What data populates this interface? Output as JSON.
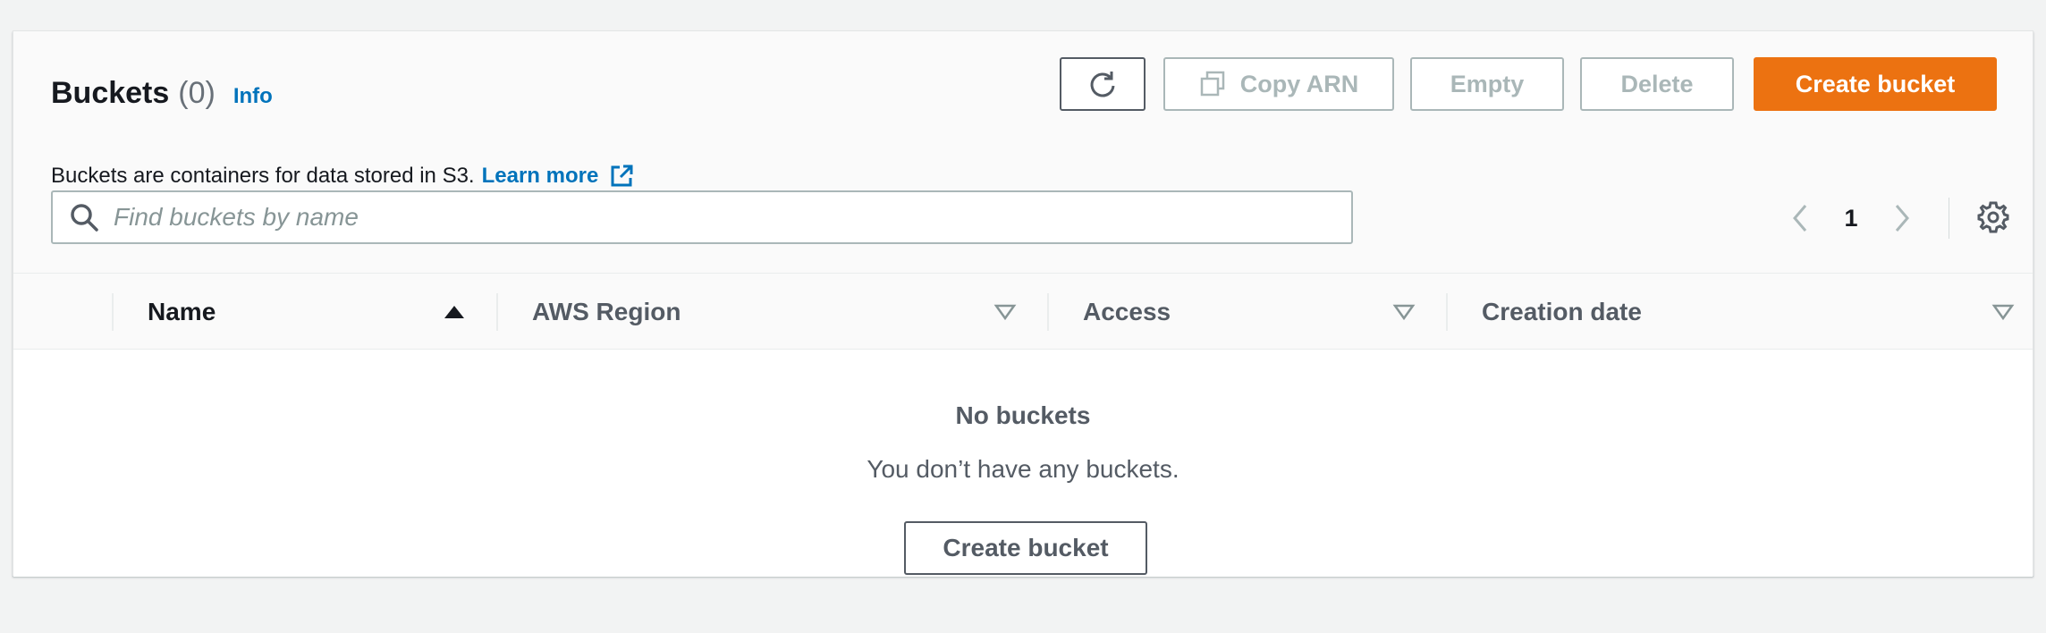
{
  "header": {
    "title": "Buckets",
    "count": "(0)",
    "info_label": "Info",
    "description": "Buckets are containers for data stored in S3.",
    "learn_more": "Learn more"
  },
  "actions": {
    "copy_arn": "Copy ARN",
    "empty": "Empty",
    "delete": "Delete",
    "create_bucket": "Create bucket"
  },
  "search": {
    "placeholder": "Find buckets by name",
    "value": ""
  },
  "pagination": {
    "current_page": "1"
  },
  "table": {
    "columns": [
      "Name",
      "AWS Region",
      "Access",
      "Creation date"
    ],
    "sorted_column": "Name",
    "sort_direction": "ascending",
    "rows": []
  },
  "empty_state": {
    "title": "No buckets",
    "description": "You don’t have any buckets.",
    "button": "Create bucket"
  },
  "icons": {
    "refresh": "refresh-icon",
    "copy": "copy-icon",
    "external_link": "external-link-icon",
    "search": "search-icon",
    "prev": "chevron-left-icon",
    "next": "chevron-right-icon",
    "settings": "gear-icon",
    "sort_asc": "sort-ascending-icon",
    "sort_none": "sort-unsorted-icon"
  },
  "colors": {
    "primary": "#ec7211",
    "link": "#0073bb",
    "disabled": "#aab7b8",
    "text": "#16191f",
    "muted": "#545b64"
  }
}
